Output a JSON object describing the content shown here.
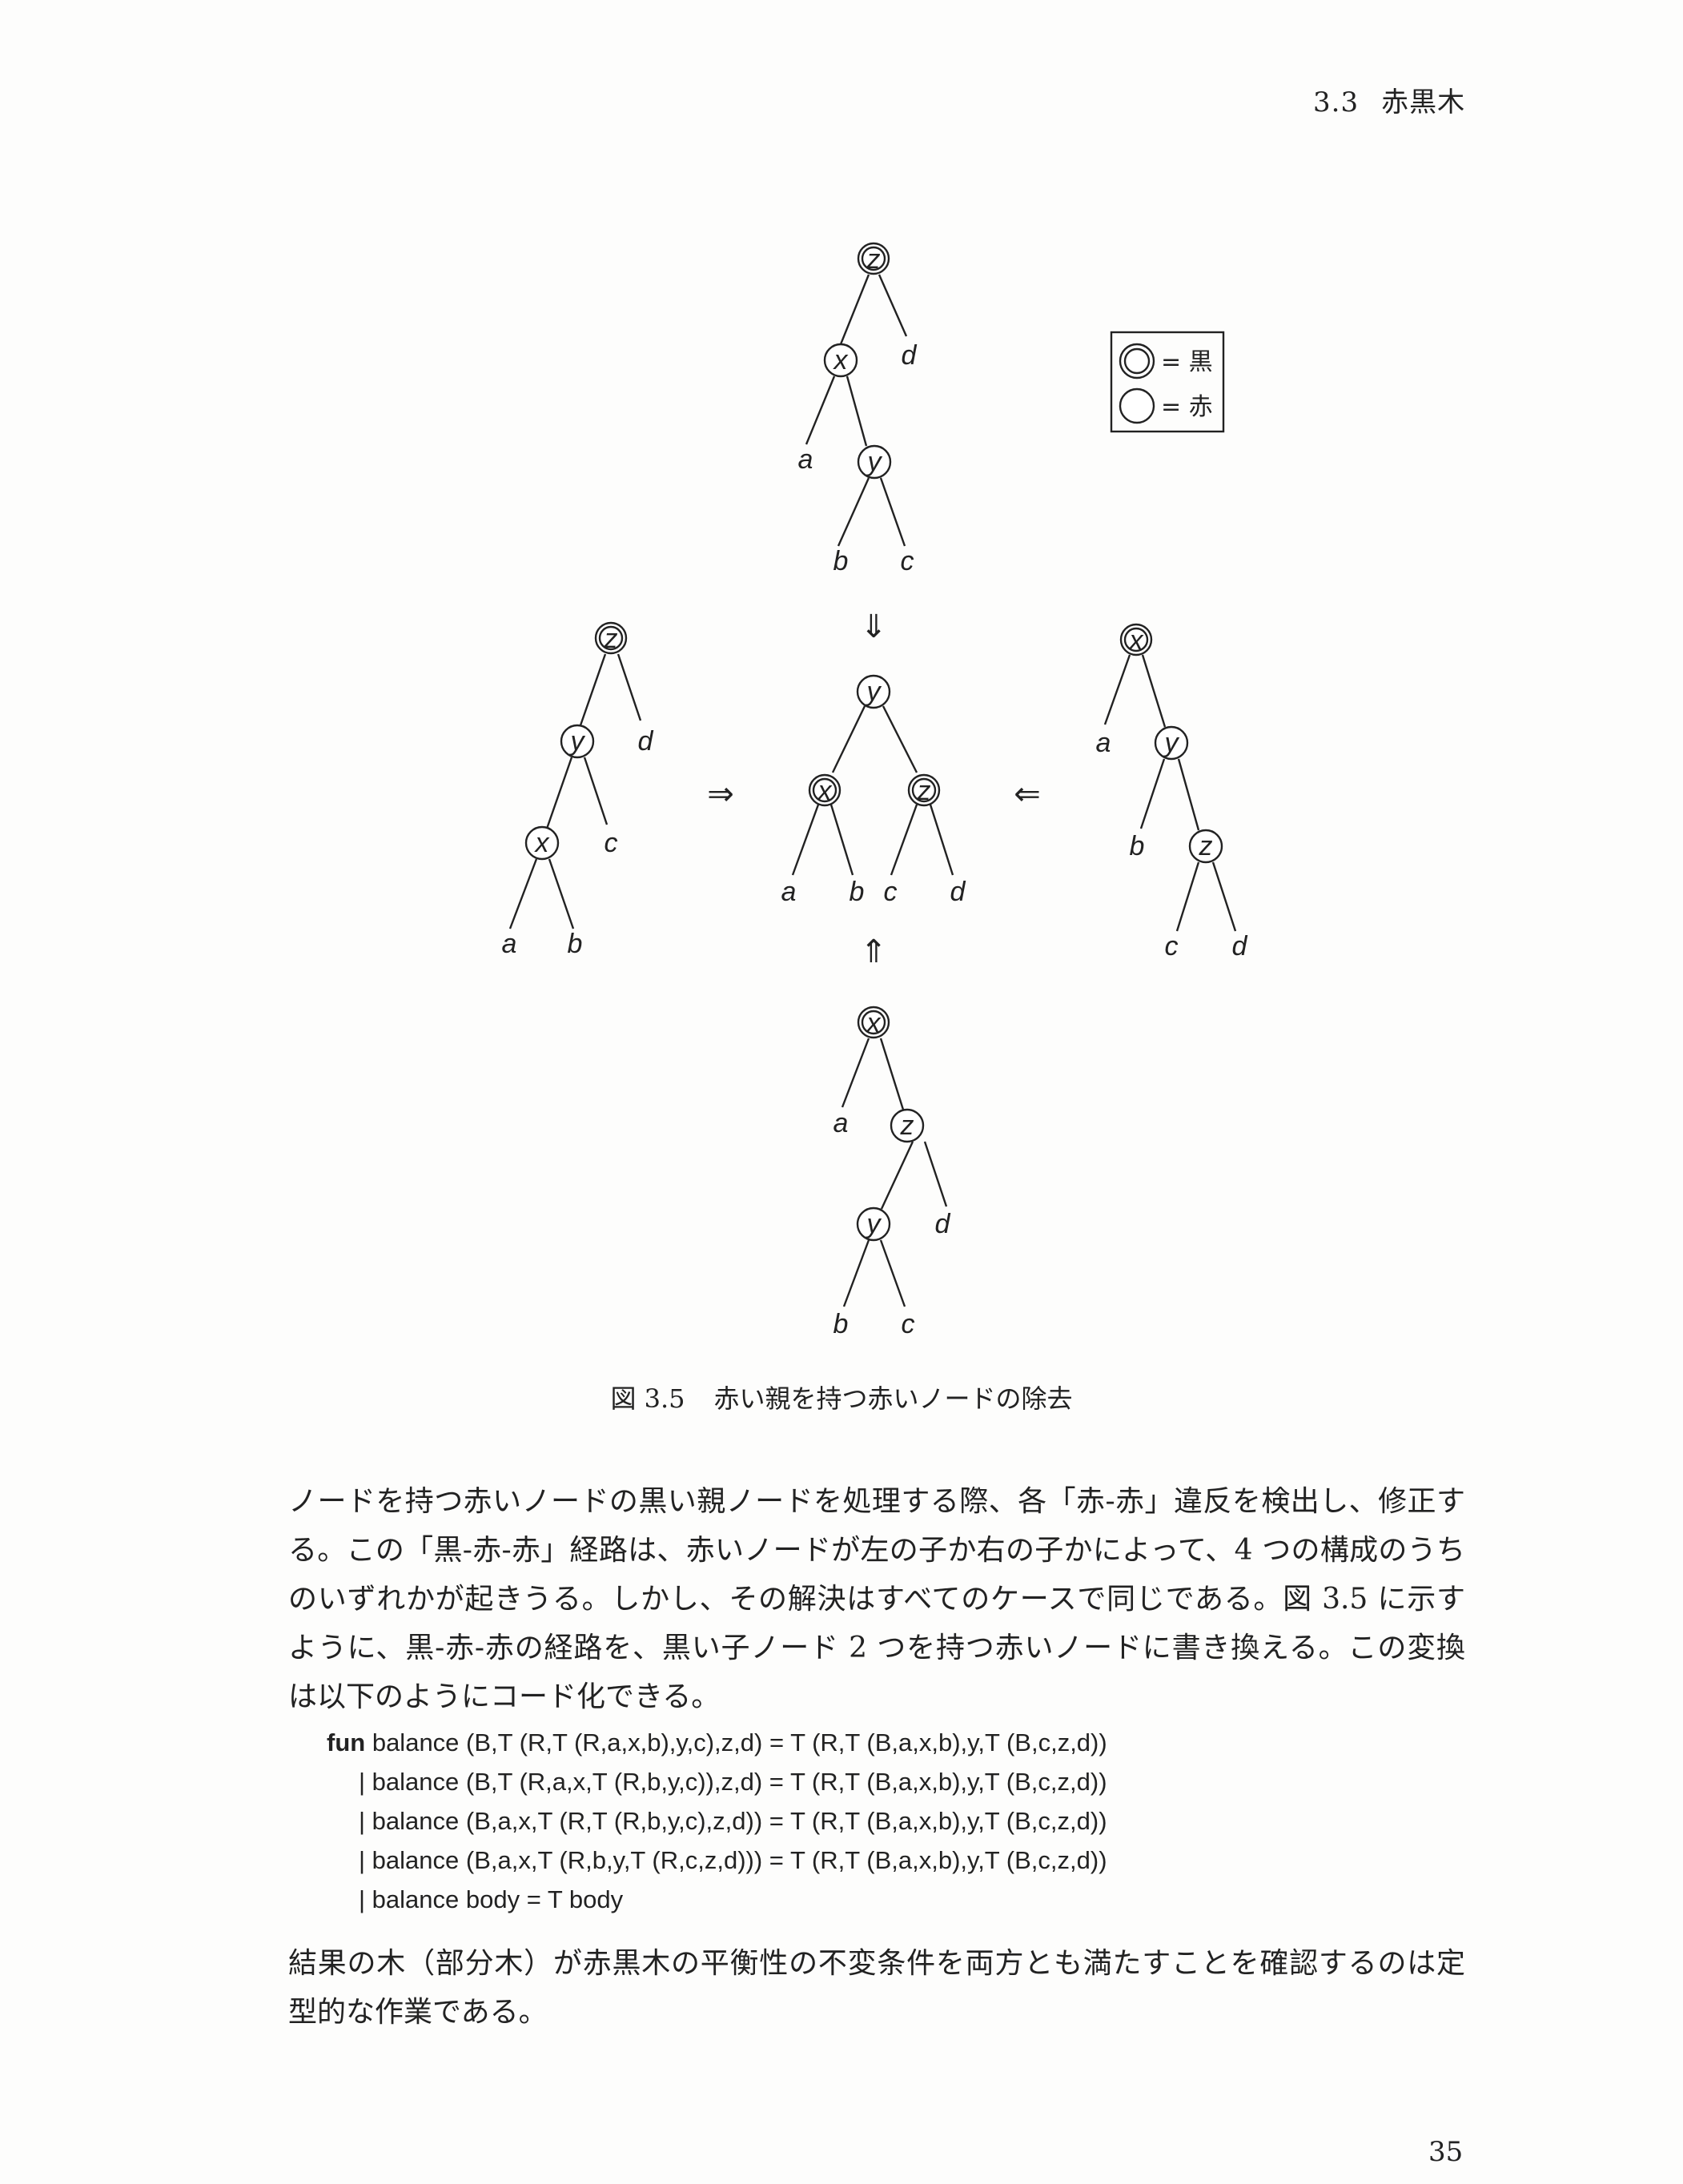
{
  "header": {
    "section_number": "3.3",
    "section_title": "赤黒木"
  },
  "legend": {
    "black_label": "= 黒",
    "red_label": "= 赤"
  },
  "figure": {
    "arrows": {
      "down": "⇓",
      "right": "⇒",
      "left": "⇐",
      "up": "⇑"
    },
    "trees": [
      {
        "id": "top",
        "nodes": [
          {
            "label": "z",
            "color": "black"
          },
          {
            "label": "x",
            "color": "red"
          },
          {
            "label": "y",
            "color": "red"
          }
        ],
        "leaves": [
          "a",
          "b",
          "c",
          "d"
        ]
      },
      {
        "id": "left",
        "nodes": [
          {
            "label": "z",
            "color": "black"
          },
          {
            "label": "y",
            "color": "red"
          },
          {
            "label": "x",
            "color": "red"
          }
        ],
        "leaves": [
          "a",
          "b",
          "c",
          "d"
        ]
      },
      {
        "id": "center",
        "nodes": [
          {
            "label": "y",
            "color": "red"
          },
          {
            "label": "x",
            "color": "black"
          },
          {
            "label": "z",
            "color": "black"
          }
        ],
        "leaves": [
          "a",
          "b",
          "c",
          "d"
        ]
      },
      {
        "id": "right",
        "nodes": [
          {
            "label": "x",
            "color": "black"
          },
          {
            "label": "y",
            "color": "red"
          },
          {
            "label": "z",
            "color": "red"
          }
        ],
        "leaves": [
          "a",
          "b",
          "c",
          "d"
        ]
      },
      {
        "id": "bottom",
        "nodes": [
          {
            "label": "x",
            "color": "black"
          },
          {
            "label": "z",
            "color": "red"
          },
          {
            "label": "y",
            "color": "red"
          }
        ],
        "leaves": [
          "a",
          "b",
          "c",
          "d"
        ]
      }
    ]
  },
  "caption": {
    "number": "図 3.5",
    "text": "赤い親を持つ赤いノードの除去"
  },
  "paragraph1": "ノードを持つ赤いノードの黒い親ノードを処理する際、各「赤-赤」違反を検出し、修正する。この「黒-赤-赤」経路は、赤いノードが左の子か右の子かによって、4 つの構成のうちのいずれかが起きうる。しかし、その解決はすべてのケースで同じである。図 3.5 に示すように、黒-赤-赤の経路を、黒い子ノード 2 つを持つ赤いノードに書き換える。この変換は以下のようにコード化できる。",
  "code": {
    "keyword": "fun",
    "line1": "balance (B,T (R,T (R,a,x,b),y,c),z,d) = T (R,T (B,a,x,b),y,T (B,c,z,d))",
    "line2": "| balance (B,T (R,a,x,T (R,b,y,c)),z,d) = T (R,T (B,a,x,b),y,T (B,c,z,d))",
    "line3": "| balance (B,a,x,T (R,T (R,b,y,c),z,d)) = T (R,T (B,a,x,b),y,T (B,c,z,d))",
    "line4": "| balance (B,a,x,T (R,b,y,T (R,c,z,d))) = T (R,T (B,a,x,b),y,T (B,c,z,d))",
    "line5": "| balance body = T body"
  },
  "paragraph2": "結果の木（部分木）が赤黒木の平衡性の不変条件を両方とも満たすことを確認するのは定型的な作業である。",
  "page_number": "35"
}
